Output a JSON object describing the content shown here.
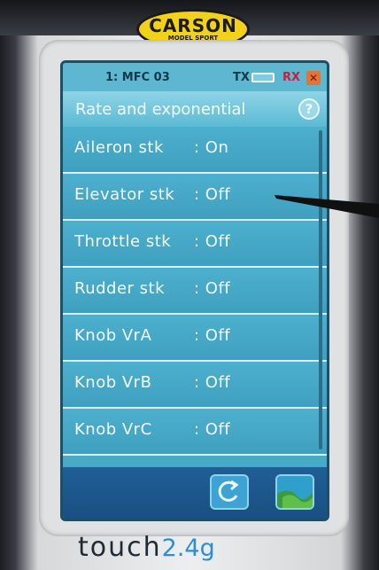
{
  "device": {
    "logo_main": "CARSON",
    "logo_sub": "MODEL SPORT",
    "brand_touch": "touch",
    "brand_freq": "2.4g"
  },
  "status": {
    "model": "1: MFC 03",
    "tx_label": "TX",
    "rx_label": "RX"
  },
  "header": {
    "title": "Rate and exponential",
    "help_icon": "?"
  },
  "items": [
    {
      "label": "Aileron stk",
      "value": ": On"
    },
    {
      "label": "Elevator stk",
      "value": ": Off"
    },
    {
      "label": "Throttle stk",
      "value": ": Off"
    },
    {
      "label": "Rudder stk",
      "value": ": Off"
    },
    {
      "label": "Knob VrA",
      "value": ": Off"
    },
    {
      "label": "Knob VrB",
      "value": ": Off"
    },
    {
      "label": "Knob VrC",
      "value": ": Off"
    }
  ],
  "icons": {
    "battery": "battery-icon",
    "mute": "speaker-muted-icon",
    "help": "help-icon",
    "back": "back-arrow-icon",
    "confirm": "confirm-icon"
  },
  "colors": {
    "screen": "#49aac8",
    "bottom_bar": "#1f5f96",
    "logo": "#f2d11a",
    "brand_accent": "#2f8ecf"
  }
}
